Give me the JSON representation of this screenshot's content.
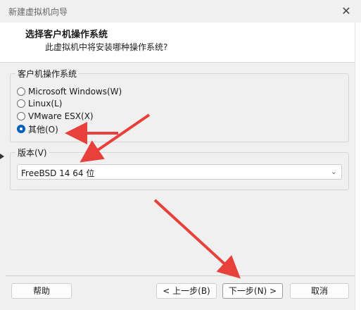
{
  "window": {
    "title": "新建虚拟机向导",
    "close_glyph": "✕",
    "close_icon": "close-icon"
  },
  "header": {
    "title": "选择客户机操作系统",
    "subtitle": "此虚拟机中将安装哪种操作系统?"
  },
  "os_group": {
    "title": "客户机操作系统",
    "options": [
      {
        "label": "Microsoft Windows(W)",
        "selected": false
      },
      {
        "label": "Linux(L)",
        "selected": false
      },
      {
        "label": "VMware ESX(X)",
        "selected": false
      },
      {
        "label": "其他(O)",
        "selected": true
      }
    ]
  },
  "version_group": {
    "title": "版本(V)",
    "selected": "FreeBSD 14 64 位",
    "chevron_icon": "chevron-down-icon",
    "chevron_glyph": "⌄"
  },
  "footer": {
    "help": "帮助",
    "back": "< 上一步(B)",
    "next": "下一步(N) >",
    "cancel": "取消"
  },
  "annotation": {
    "arrow_color": "#e8403a"
  }
}
